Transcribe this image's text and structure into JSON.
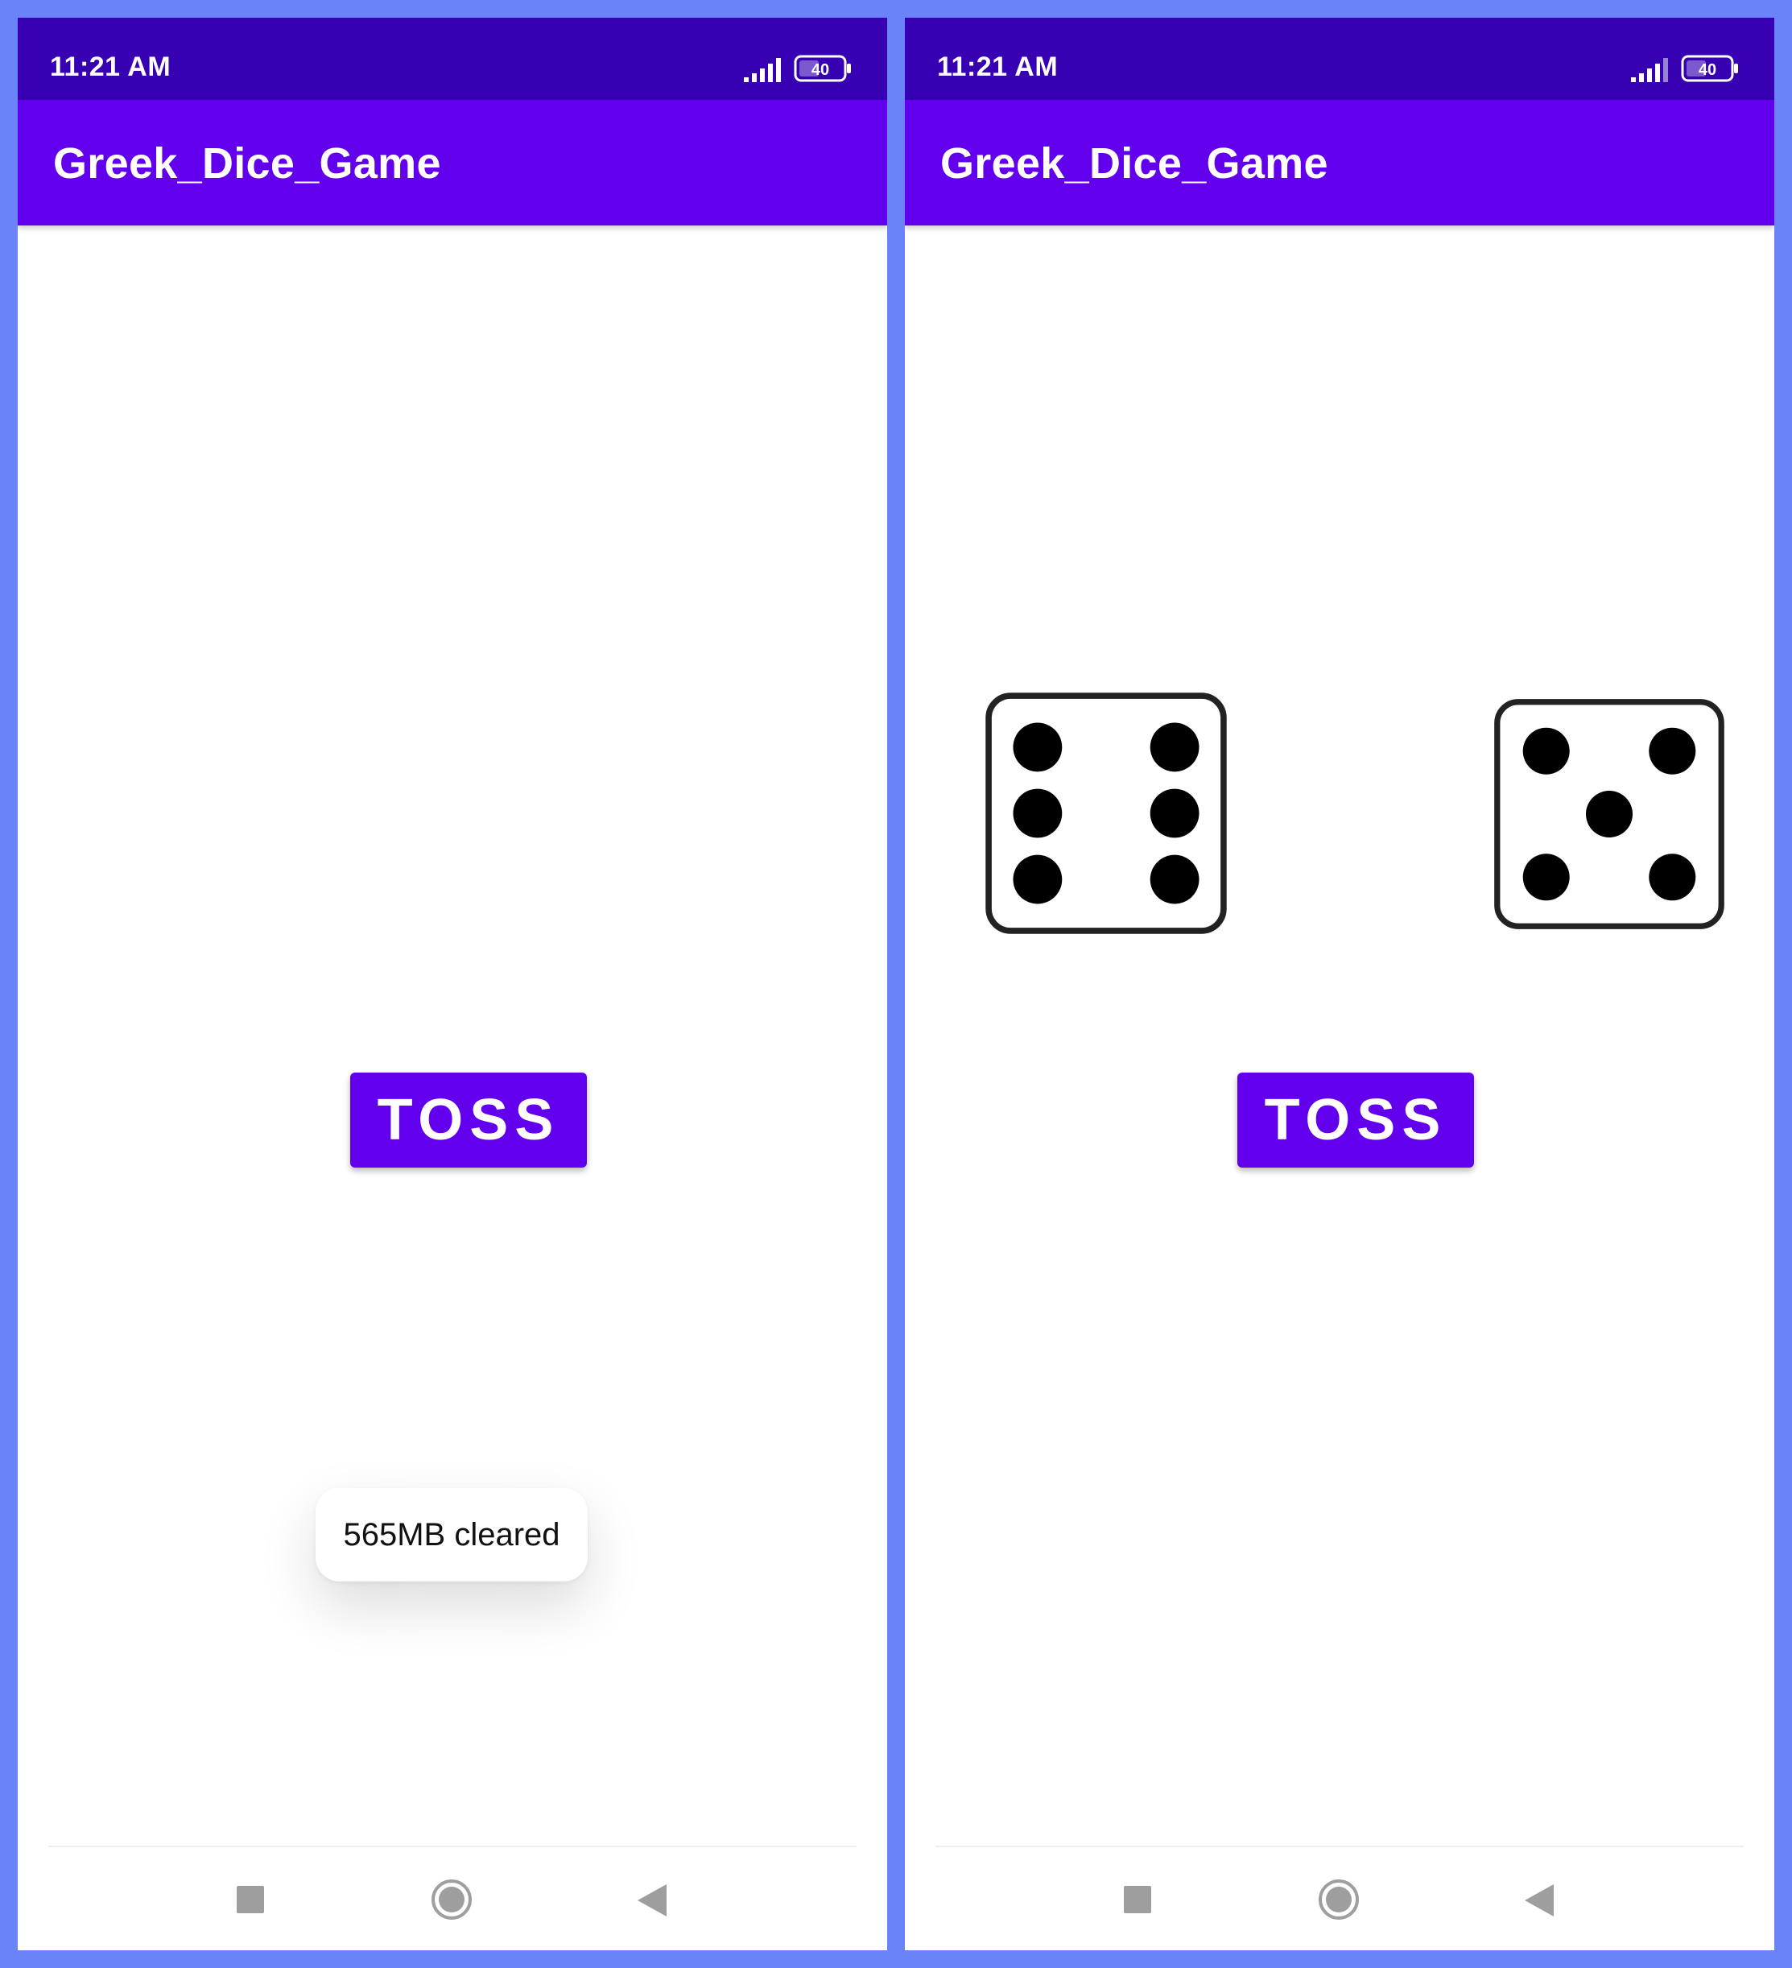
{
  "screens": [
    {
      "status_bar": {
        "time": "11:21 AM",
        "battery_level": "40",
        "signal_icon": "signal-bars-icon",
        "battery_icon": "battery-icon"
      },
      "app_bar": {
        "title": "Greek_Dice_Game"
      },
      "toss_button": {
        "label": "TOSS"
      },
      "toast": {
        "message": "565MB cleared"
      },
      "nav_bar": {
        "recent_icon": "square-recent-apps-icon",
        "home_icon": "circle-home-icon",
        "back_icon": "triangle-back-icon"
      }
    },
    {
      "status_bar": {
        "time": "11:21 AM",
        "battery_level": "40",
        "signal_icon": "signal-bars-icon",
        "battery_icon": "battery-icon"
      },
      "app_bar": {
        "title": "Greek_Dice_Game"
      },
      "dice": [
        {
          "value": 6
        },
        {
          "value": 5
        }
      ],
      "toss_button": {
        "label": "TOSS"
      },
      "nav_bar": {
        "recent_icon": "square-recent-apps-icon",
        "home_icon": "circle-home-icon",
        "back_icon": "triangle-back-icon"
      }
    }
  ],
  "colors": {
    "frame_background": "#6b83f8",
    "status_bar": "#3700b3",
    "app_bar": "#6200ee",
    "button": "#6200ee",
    "nav_icon": "#9e9e9e"
  }
}
